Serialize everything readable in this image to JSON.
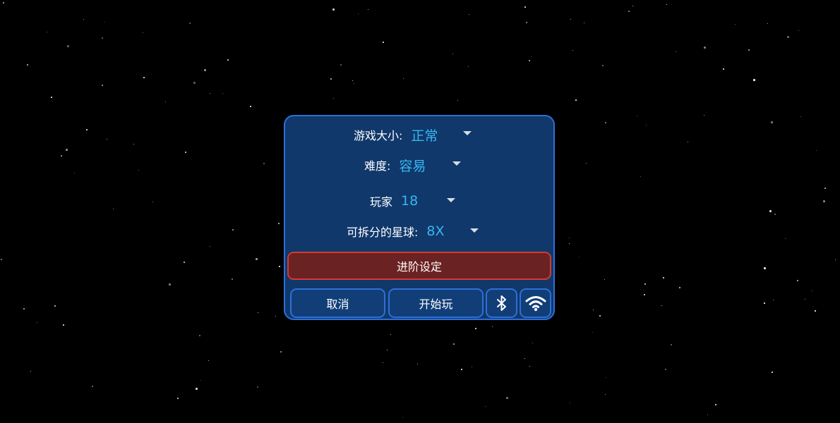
{
  "settings": {
    "game_size": {
      "label": "游戏大小:",
      "value": "正常"
    },
    "difficulty": {
      "label": "难度:",
      "value": "容易"
    },
    "players": {
      "label": "玩家",
      "value": "18"
    },
    "splittable_planets": {
      "label": "可拆分的星球:",
      "value": "8X"
    }
  },
  "buttons": {
    "advanced_settings": "进阶设定",
    "cancel": "取消",
    "start": "开始玩"
  },
  "icons": {
    "dropdown": "chevron-down-icon",
    "bluetooth": "bluetooth-icon",
    "wifi": "wifi-icon"
  },
  "colors": {
    "background": "#000000",
    "panel": "#10386b",
    "panel_border": "#2e6fd6",
    "value_text": "#38b6f0",
    "advanced_button": "#6b2222",
    "advanced_border": "#d33a30"
  }
}
